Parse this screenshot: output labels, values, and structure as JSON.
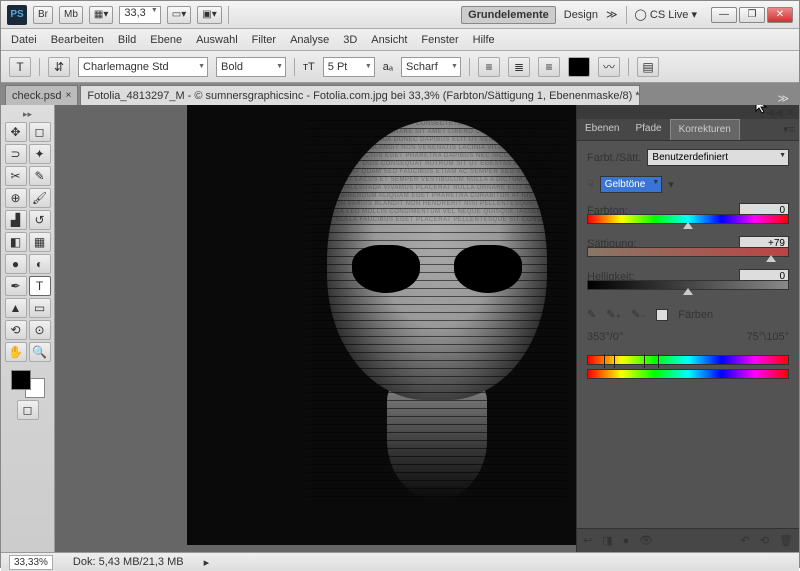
{
  "topbar": {
    "ps": "PS",
    "br": "Br",
    "mb": "Mb",
    "zoom": "33,3",
    "ws_active": "Grundelemente",
    "ws_design": "Design",
    "cs_live": "CS Live"
  },
  "win": {
    "min": "—",
    "max": "❐",
    "close": "✕"
  },
  "menu": {
    "datei": "Datei",
    "bearbeiten": "Bearbeiten",
    "bild": "Bild",
    "ebene": "Ebene",
    "auswahl": "Auswahl",
    "filter": "Filter",
    "analyse": "Analyse",
    "dd": "3D",
    "ansicht": "Ansicht",
    "fenster": "Fenster",
    "hilfe": "Hilfe"
  },
  "optbar": {
    "font": "Charlemagne Std",
    "weight": "Bold",
    "size": "5 Pt",
    "aa": "Scharf"
  },
  "tabs": {
    "t1": "check.psd",
    "t2": "Fotolia_4813297_M - © sumnersgraphicsinc - Fotolia.com.jpg bei 33,3% (Farbton/Sättigung 1, Ebenenmaske/8) *"
  },
  "panel": {
    "tabs": {
      "ebenen": "Ebenen",
      "pfade": "Pfade",
      "korrekturen": "Korrekturen"
    },
    "title": "Farbt./Sätt.",
    "preset": "Benutzerdefiniert",
    "channel": "Gelbtöne",
    "farbton_lbl": "Farbton:",
    "farbton_val": "0",
    "saett_lbl": "Sättigung:",
    "saett_val": "+79",
    "hell_lbl": "Helligkeit:",
    "hell_val": "0",
    "faerben": "Färben",
    "range_left": "353°/0°",
    "range_right": "75°\\105°"
  },
  "status": {
    "zoom": "33,33%",
    "dok": "Dok: 5,43 MB/21,3 MB"
  },
  "chart_data": {
    "type": "table",
    "title": "Hue/Saturation Adjustment",
    "channel": "Gelbtöne",
    "values": {
      "Farbton": 0,
      "Sättigung": 79,
      "Helligkeit": 0
    },
    "range_degrees": {
      "falloff_start": 353,
      "start": 0,
      "end": 75,
      "falloff_end": 105
    }
  }
}
